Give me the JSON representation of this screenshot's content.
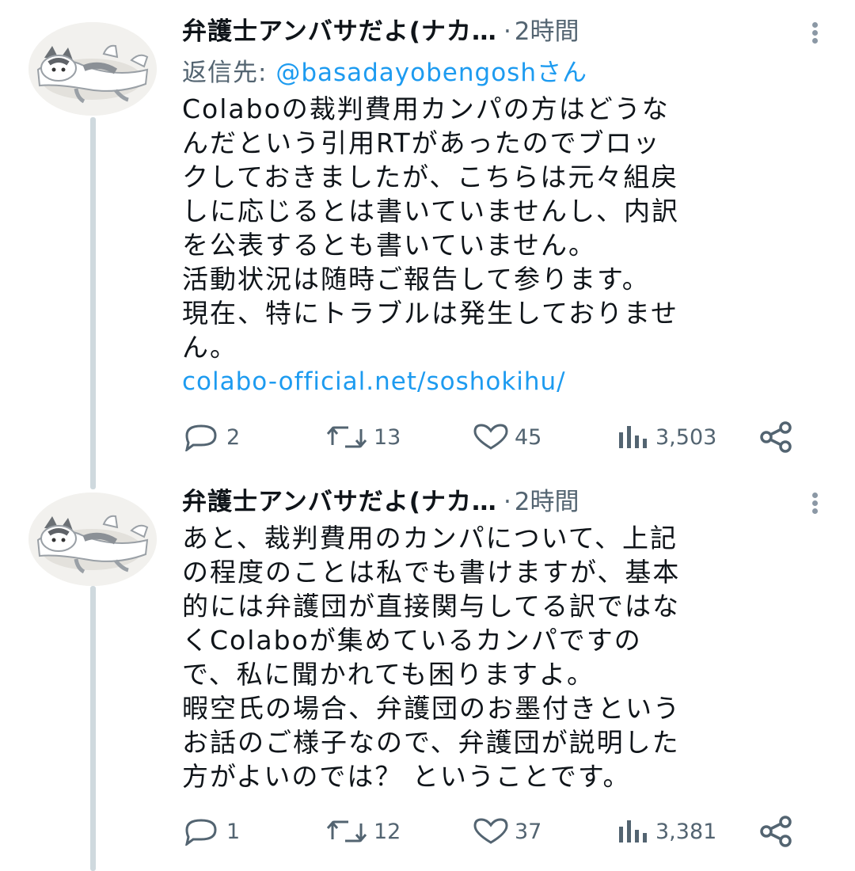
{
  "tweets": [
    {
      "author": "弁護士アンバサだよ(ナカ…",
      "time": "2時間",
      "reply_prefix": "返信先: ",
      "reply_handle": "@basadayobengoshさん",
      "lines": [
        "Colaboの裁判費用カンパの方はどうな",
        "んだという引用RTがあったのでブロッ",
        "クしておきましたが、こちらは元々組戻",
        "しに応じるとは書いていませんし、内訳",
        "を公表するとも書いていません。",
        "活動状況は随時ご報告して参ります。",
        "現在、特にトラブルは発生しておりませ",
        "ん。"
      ],
      "link": "colabo-official.net/soshokihu/",
      "stats": {
        "replies": "2",
        "retweets": "13",
        "likes": "45",
        "views": "3,503"
      }
    },
    {
      "author": "弁護士アンバサだよ(ナカ…",
      "time": "2時間",
      "lines": [
        "あと、裁判費用のカンパについて、上記",
        "の程度のことは私でも書けますが、基本",
        "的には弁護団が直接関与してる訳ではな",
        "くColaboが集めているカンパですの",
        "で、私に聞かれても困りますよ。",
        "暇空氏の場合、弁護団のお墨付きという",
        "お話のご様子なので、弁護団が説明した",
        "方がよいのでは？ ということです。"
      ],
      "stats": {
        "replies": "1",
        "retweets": "12",
        "likes": "37",
        "views": "3,381"
      }
    }
  ],
  "icons": {
    "more": "more-vertical-icon",
    "reply": "reply-bubble-icon",
    "retweet": "retweet-icon",
    "like": "heart-icon",
    "views": "views-bar-icon",
    "share": "share-icon"
  },
  "colors": {
    "text": "#0f1419",
    "secondary": "#536471",
    "link": "#1d9bf0",
    "thread_line": "#cfd9de"
  }
}
